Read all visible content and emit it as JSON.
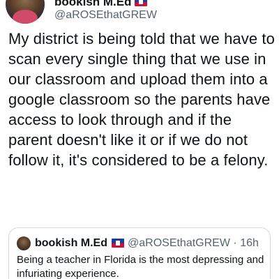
{
  "tweet": {
    "author": {
      "display_name": "bookish M.Ed",
      "handle": "@aROSEthatGREW",
      "flag_icon": "haiti-flag-icon"
    },
    "text": "My district is being told that we have to scan every single thing that we use in our classroom and upload them into a google classroom so the parents have access to look through and if the parent doesn't like it or if we do not follow it, it's considered to be a felony."
  },
  "quoted_tweet": {
    "display_name": "bookish M.Ed",
    "handle": "@aROSEthatGREW",
    "separator": "·",
    "time": "16h",
    "text": "Being a teacher in Florida is the most depressing and infuriating experience."
  },
  "colors": {
    "text_primary": "#0f1419",
    "text_secondary": "#536471",
    "border": "#cfd9de",
    "flag_blue": "#1d3f9a",
    "flag_red": "#d21034"
  }
}
